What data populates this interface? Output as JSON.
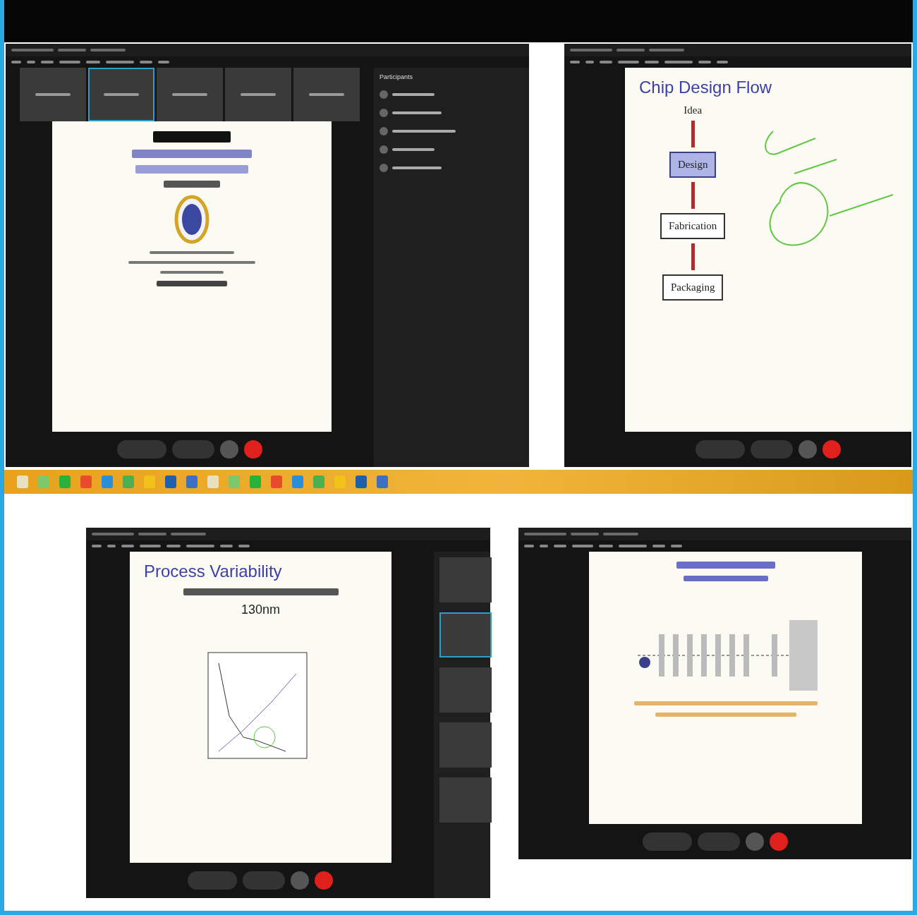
{
  "top_row": [
    {
      "kind": "title_slide",
      "panel": {
        "title": "Participants"
      }
    },
    {
      "kind": "flow",
      "title": "Chip Design Flow",
      "steps": [
        {
          "label": "Idea",
          "kind": "plain"
        },
        {
          "label": "Design",
          "kind": "filled"
        },
        {
          "label": "Fabrication",
          "kind": "outlined"
        },
        {
          "label": "Packaging",
          "kind": "outlined"
        }
      ]
    }
  ],
  "bottom_row": [
    {
      "kind": "graph",
      "title": "Process Variability",
      "subtitle": "130nm"
    },
    {
      "kind": "diagram"
    }
  ]
}
